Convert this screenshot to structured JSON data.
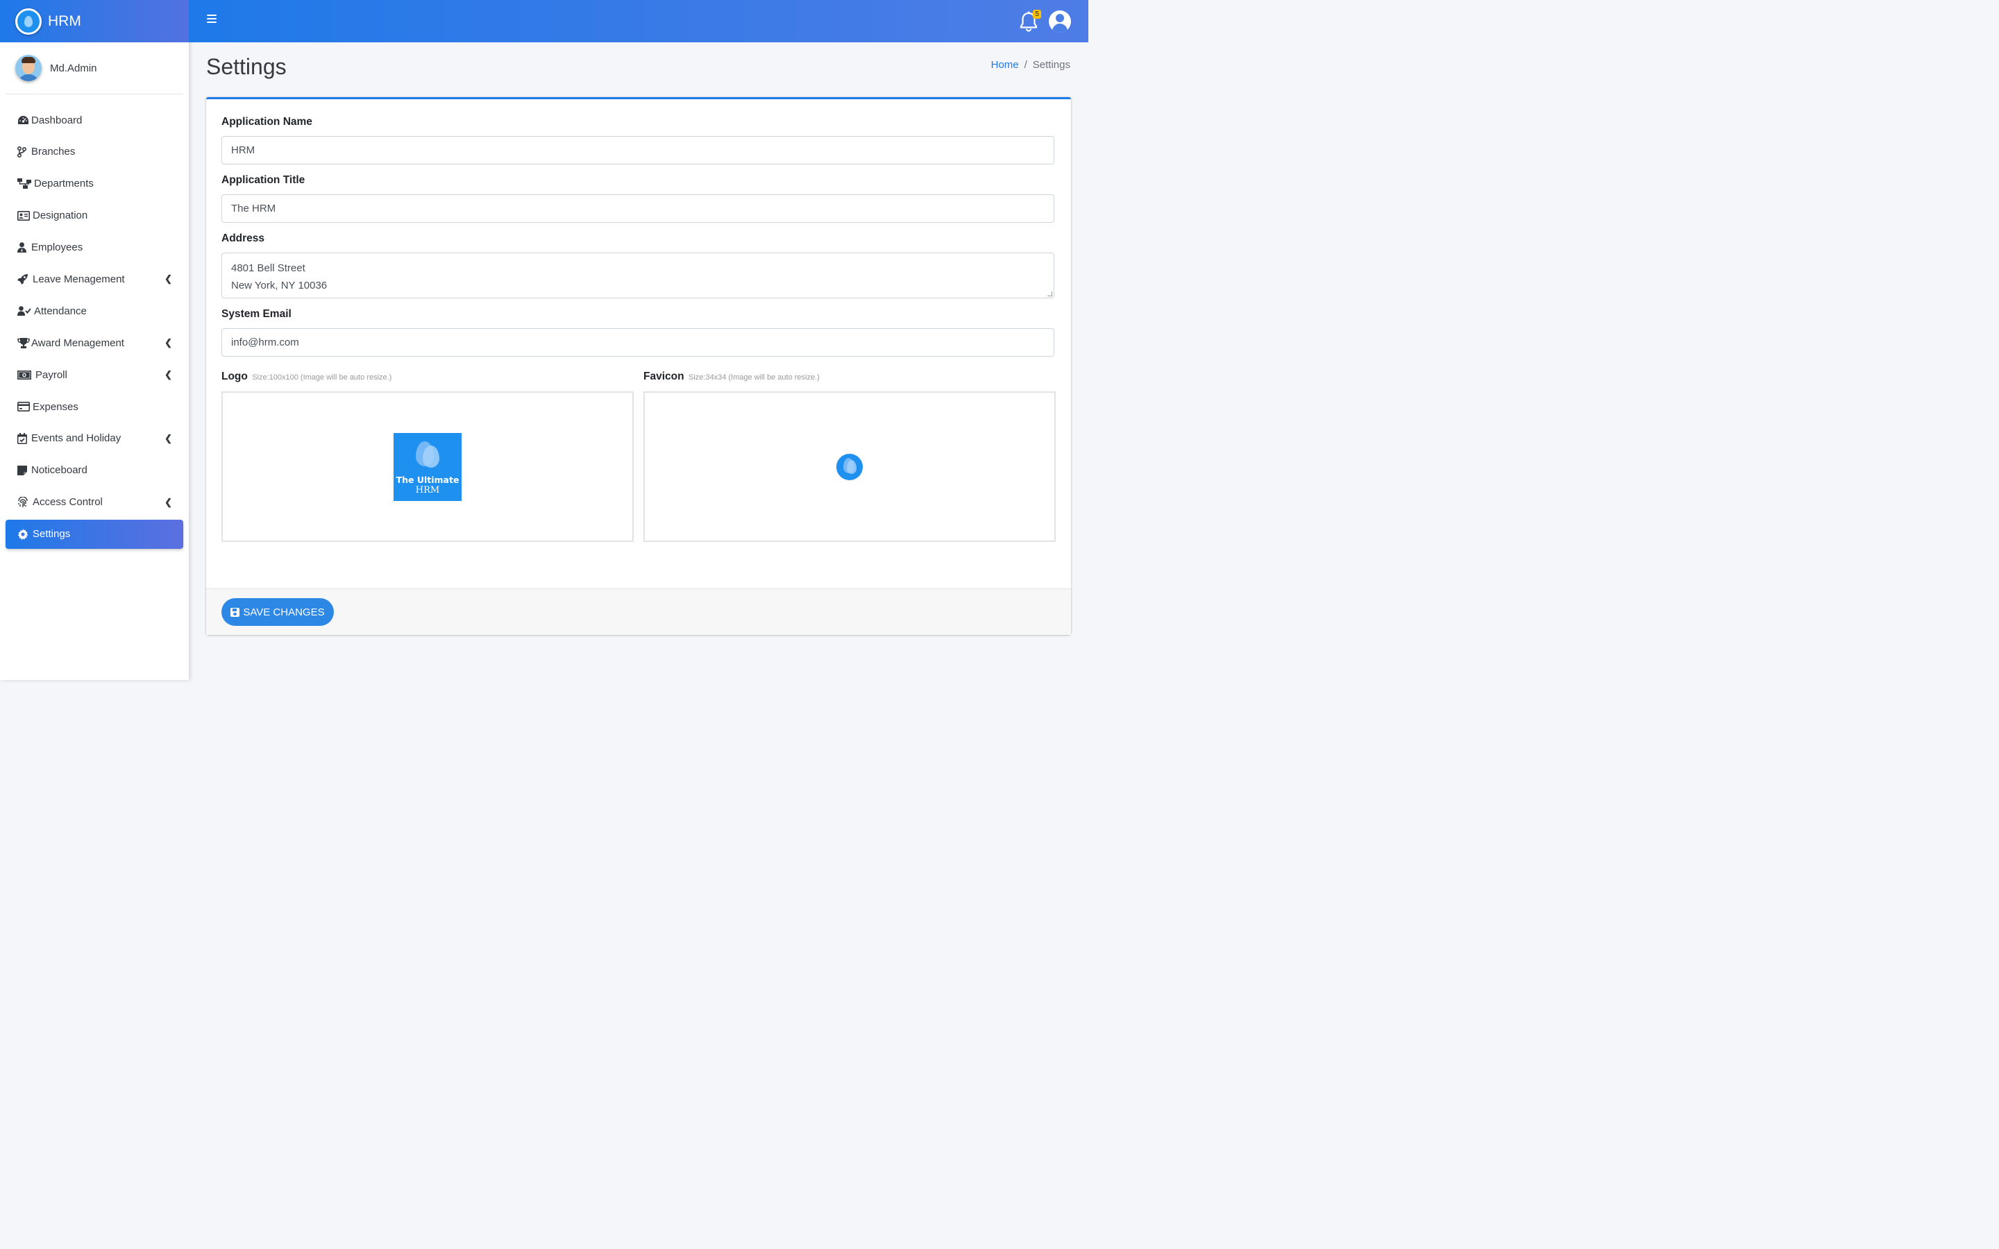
{
  "brand": {
    "name": "HRM",
    "logo_icon": "drop-logo-icon"
  },
  "user": {
    "name": "Md.Admin"
  },
  "sidebar": {
    "items": [
      {
        "label": "Dashboard",
        "icon": "tachometer-icon",
        "has_submenu": false
      },
      {
        "label": "Branches",
        "icon": "code-branch-icon",
        "has_submenu": false
      },
      {
        "label": "Departments",
        "icon": "sitemap-icon",
        "has_submenu": false
      },
      {
        "label": "Designation",
        "icon": "id-card-icon",
        "has_submenu": false
      },
      {
        "label": "Employees",
        "icon": "user-tie-icon",
        "has_submenu": false
      },
      {
        "label": "Leave Menagement",
        "icon": "rocket-icon",
        "has_submenu": true
      },
      {
        "label": "Attendance",
        "icon": "user-check-icon",
        "has_submenu": false
      },
      {
        "label": "Award Menagement",
        "icon": "trophy-icon",
        "has_submenu": true
      },
      {
        "label": "Payroll",
        "icon": "money-bill-icon",
        "has_submenu": true
      },
      {
        "label": "Expenses",
        "icon": "credit-card-icon",
        "has_submenu": false
      },
      {
        "label": "Events and Holiday",
        "icon": "calendar-check-icon",
        "has_submenu": true
      },
      {
        "label": "Noticeboard",
        "icon": "sticky-note-icon",
        "has_submenu": false
      },
      {
        "label": "Access Control",
        "icon": "fingerprint-icon",
        "has_submenu": true
      },
      {
        "label": "Settings",
        "icon": "cog-icon",
        "has_submenu": false,
        "active": true
      }
    ]
  },
  "topbar": {
    "notification_count": "5"
  },
  "page": {
    "title": "Settings"
  },
  "breadcrumb": {
    "home": "Home",
    "separator": "/",
    "current": "Settings"
  },
  "form": {
    "app_name": {
      "label": "Application Name",
      "value": "HRM"
    },
    "app_title": {
      "label": "Application Title",
      "value": "The HRM"
    },
    "address": {
      "label": "Address",
      "line1": "4801 Bell Street",
      "line2": "New York, NY 10036"
    },
    "system_email": {
      "label": "System Email",
      "value": "info@hrm.com"
    },
    "logo": {
      "label": "Logo",
      "hint": "Size:100x100 (Image will be auto resize.)",
      "image_line1": "The Ultimate",
      "image_line2": "HRM"
    },
    "favicon": {
      "label": "Favicon",
      "hint": "Size:34x34 (Image will be auto resize.)"
    }
  },
  "footer": {
    "save_label": "SAVE CHANGES"
  },
  "colors": {
    "accent": "#1f79e8",
    "brand_gradient_end": "#5c6fe0",
    "badge": "#ffc107"
  }
}
